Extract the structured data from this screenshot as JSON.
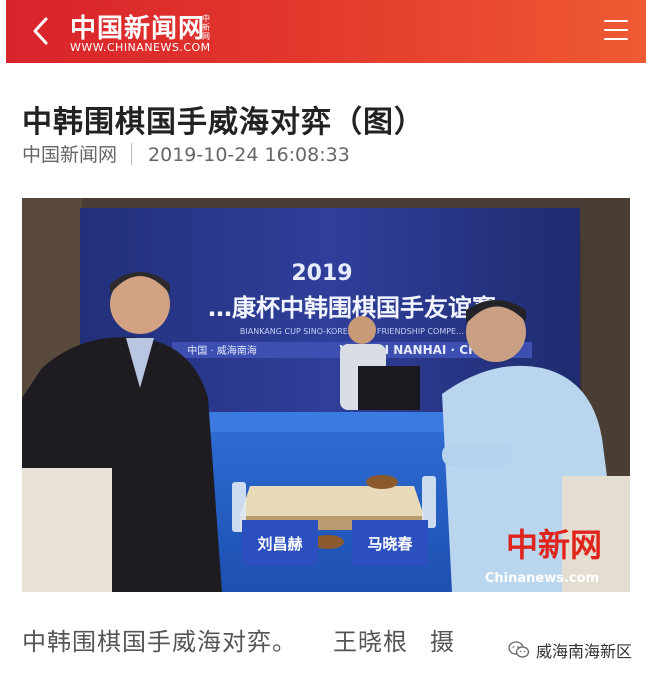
{
  "header": {
    "logo_cn": "中国新闻网",
    "logo_en": "WWW.CHINANEWS.COM",
    "logo_tag": "中新网",
    "colors": {
      "start": "#d8232b",
      "end": "#ef5a33"
    }
  },
  "article": {
    "title": "中韩围棋国手威海对弈（图）",
    "source": "中国新闻网",
    "datetime": "2019-10-24 16:08:33"
  },
  "photo": {
    "banner_year": "2019",
    "banner_title": "…康杯中韩围棋国手友谊赛",
    "banner_en": "BIANKANG CUP SINO-KOREAN GO FRIENDSHIP COMPE…",
    "banner_place_cn": "中国 · 威海南海",
    "banner_place_en": "WEIHAI NANHAI · CHIN…",
    "nameplate_left": "刘昌赫",
    "nameplate_right": "马晓春",
    "watermark_cn": "中新网",
    "watermark_en": "Chinanews.com"
  },
  "caption": {
    "text": "中韩围棋国手威海对弈。",
    "author": "王晓根",
    "credit": "摄"
  },
  "wechat_watermark": {
    "label": "威海南海新区",
    "icon": "wechat-icon"
  }
}
